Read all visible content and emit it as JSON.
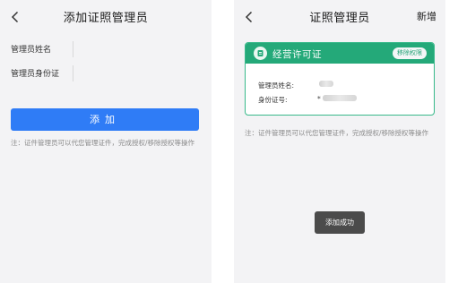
{
  "left": {
    "title": "添加证照管理员",
    "form": {
      "name_label": "管理员姓名",
      "id_label": "管理员身份证",
      "name_value": "",
      "id_value": ""
    },
    "submit_label": "添加",
    "note": "注：证件管理员可以代您管理证件，完成授权/移除授权等操作"
  },
  "right": {
    "title": "证照管理员",
    "add_label": "新增",
    "card": {
      "title": "经营许可证",
      "remove_label": "移除权限",
      "admin_label": "管理员姓名:",
      "id_label": "身份证号:",
      "id_prefix": "*"
    },
    "note": "注：证件管理员可以代您管理证件，完成授权/移除授权等操作",
    "toast": "添加成功"
  },
  "colors": {
    "primary": "#2f7cf6",
    "card_green": "#24a979"
  }
}
